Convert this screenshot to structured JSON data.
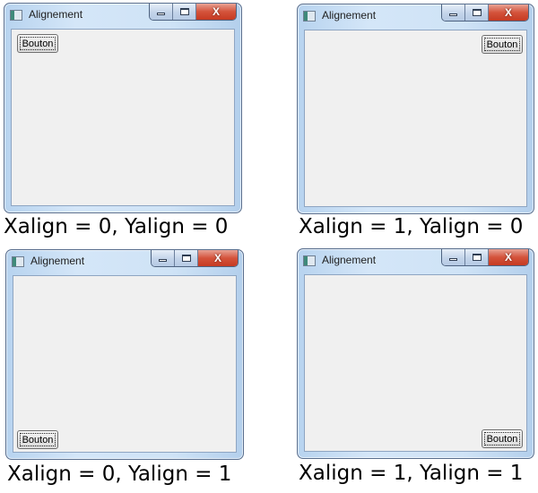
{
  "window_title": "Alignement",
  "button_label": "Bouton",
  "controls": {
    "minimize": "",
    "maximize": "",
    "close": "X"
  },
  "demos": [
    {
      "caption": "Xalign = 0, Yalign = 0",
      "xalign": 0,
      "yalign": 0
    },
    {
      "caption": "Xalign = 1, Yalign = 0",
      "xalign": 1,
      "yalign": 0
    },
    {
      "caption": "Xalign = 0, Yalign = 1",
      "xalign": 0,
      "yalign": 1
    },
    {
      "caption": "Xalign = 1, Yalign = 1",
      "xalign": 1,
      "yalign": 1
    }
  ]
}
